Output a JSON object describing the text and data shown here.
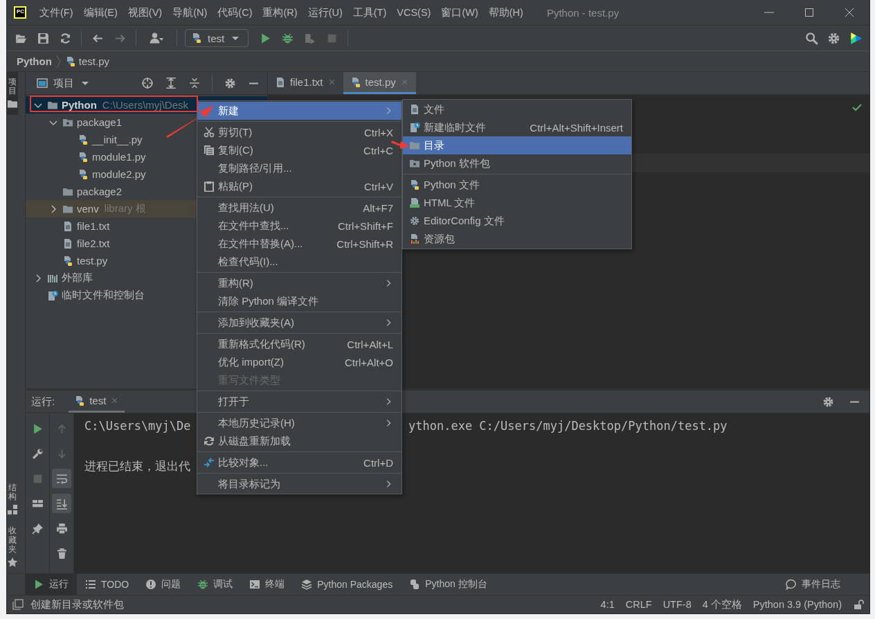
{
  "window": {
    "logo_text": "PC",
    "title": "Python - test.py"
  },
  "menu_bar": [
    "文件(F)",
    "编辑(E)",
    "视图(V)",
    "导航(N)",
    "代码(C)",
    "重构(R)",
    "运行(U)",
    "工具(T)",
    "VCS(S)",
    "窗口(W)",
    "帮助(H)"
  ],
  "toolbar": {
    "run_config": "test"
  },
  "breadcrumb": [
    "Python",
    "test.py"
  ],
  "left_stripe": {
    "top": [
      {
        "label": "项目",
        "selected": true
      }
    ],
    "bottom": [
      {
        "label": "结构",
        "kind": "structure",
        "selected": false
      },
      {
        "label": "收藏夹",
        "kind": "star",
        "selected": false
      }
    ]
  },
  "project_panel": {
    "title": "项目",
    "tree": [
      {
        "name": "Python",
        "hint": "C:\\Users\\myj\\Desk",
        "kind": "folder",
        "expanded": true,
        "selected": true,
        "excluded": false,
        "children": [
          {
            "name": "package1",
            "kind": "package",
            "expanded": true,
            "selected": false,
            "excluded": false,
            "children": [
              {
                "name": "__init__.py",
                "kind": "python",
                "selected": false,
                "excluded": false
              },
              {
                "name": "module1.py",
                "kind": "python",
                "selected": false,
                "excluded": false
              },
              {
                "name": "module2.py",
                "kind": "python",
                "selected": false,
                "excluded": false
              }
            ]
          },
          {
            "name": "package2",
            "kind": "folder",
            "selected": false,
            "excluded": false
          },
          {
            "name": "venv",
            "hint": "library 根",
            "kind": "folder",
            "expanded": false,
            "selected": false,
            "excluded": true
          },
          {
            "name": "file1.txt",
            "kind": "text",
            "selected": false,
            "excluded": false
          },
          {
            "name": "file2.txt",
            "kind": "text",
            "selected": false,
            "excluded": false
          },
          {
            "name": "test.py",
            "kind": "python",
            "selected": false,
            "excluded": false
          }
        ]
      },
      {
        "name": "外部库",
        "kind": "library",
        "expanded": false,
        "selected": false,
        "excluded": false
      },
      {
        "name": "临时文件和控制台",
        "kind": "scratch",
        "selected": false,
        "excluded": false
      }
    ]
  },
  "editor": {
    "tabs": [
      {
        "label": "file1.txt",
        "kind": "text",
        "selected": false
      },
      {
        "label": "test.py",
        "kind": "python",
        "selected": true
      }
    ]
  },
  "run_panel": {
    "title": "运行:",
    "tabs": [
      {
        "label": "test",
        "selected": true
      }
    ],
    "tools_left": [
      {
        "kind": "run"
      },
      {
        "kind": "wrench"
      },
      {
        "kind": "stop"
      },
      {
        "kind": "layout"
      },
      {
        "kind": "pin"
      }
    ],
    "tools_right": [
      {
        "kind": "up",
        "toggled": false
      },
      {
        "kind": "down",
        "toggled": false
      },
      {
        "kind": "wrap",
        "toggled": true
      },
      {
        "kind": "scroll-end",
        "toggled": true
      },
      {
        "kind": "print",
        "toggled": false
      },
      {
        "kind": "trash",
        "toggled": false
      }
    ],
    "console": [
      [
        "C:\\Users\\myj\\De",
        "ython.exe C:/Users/myj/Desktop/Python/test.py"
      ],
      [
        "进程已结束，退出代"
      ]
    ]
  },
  "tool_tabs": [
    {
      "label": "运行",
      "kind": "run",
      "selected": true
    },
    {
      "label": "TODO",
      "kind": "todo",
      "selected": false
    },
    {
      "label": "问题",
      "kind": "problems",
      "selected": false
    },
    {
      "label": "调试",
      "kind": "debug",
      "selected": false
    },
    {
      "label": "终端",
      "kind": "terminal",
      "selected": false
    },
    {
      "label": "Python Packages",
      "kind": "packages",
      "selected": false
    },
    {
      "label": "Python 控制台",
      "kind": "console",
      "selected": false
    }
  ],
  "event_log": "事件日志",
  "status_bar": {
    "message": "创建新目录或软件包",
    "items": [
      "4:1",
      "CRLF",
      "UTF-8",
      "4 个空格",
      "Python 3.9 (Python)"
    ]
  },
  "context_menu": {
    "groups": [
      [
        {
          "label": "新建",
          "submenu": true,
          "selected": true,
          "disabled": false
        }
      ],
      [
        {
          "label": "剪切(T)",
          "shortcut": "Ctrl+X",
          "submenu": false,
          "selected": false,
          "disabled": false
        },
        {
          "label": "复制(C)",
          "shortcut": "Ctrl+C",
          "submenu": false,
          "selected": false,
          "disabled": false
        },
        {
          "label": "复制路径/引用...",
          "submenu": false,
          "selected": false,
          "disabled": false
        },
        {
          "label": "粘贴(P)",
          "shortcut": "Ctrl+V",
          "submenu": false,
          "selected": false,
          "disabled": false
        }
      ],
      [
        {
          "label": "查找用法(U)",
          "shortcut": "Alt+F7",
          "submenu": false,
          "selected": false,
          "disabled": false
        },
        {
          "label": "在文件中查找...",
          "shortcut": "Ctrl+Shift+F",
          "submenu": false,
          "selected": false,
          "disabled": false
        },
        {
          "label": "在文件中替换(A)...",
          "shortcut": "Ctrl+Shift+R",
          "submenu": false,
          "selected": false,
          "disabled": false
        },
        {
          "label": "检查代码(I)...",
          "submenu": false,
          "selected": false,
          "disabled": false
        }
      ],
      [
        {
          "label": "重构(R)",
          "submenu": true,
          "selected": false,
          "disabled": false
        },
        {
          "label": "清除 Python 编译文件",
          "submenu": false,
          "selected": false,
          "disabled": false
        }
      ],
      [
        {
          "label": "添加到收藏夹(A)",
          "submenu": true,
          "selected": false,
          "disabled": false
        }
      ],
      [
        {
          "label": "重新格式化代码(R)",
          "shortcut": "Ctrl+Alt+L",
          "submenu": false,
          "selected": false,
          "disabled": false
        },
        {
          "label": "优化 import(Z)",
          "shortcut": "Ctrl+Alt+O",
          "submenu": false,
          "selected": false,
          "disabled": false
        },
        {
          "label": "重写文件类型",
          "submenu": false,
          "selected": false,
          "disabled": true
        }
      ],
      [
        {
          "label": "打开于",
          "submenu": true,
          "selected": false,
          "disabled": false
        }
      ],
      [
        {
          "label": "本地历史记录(H)",
          "submenu": true,
          "selected": false,
          "disabled": false
        },
        {
          "label": "从磁盘重新加载",
          "submenu": false,
          "selected": false,
          "disabled": false
        }
      ],
      [
        {
          "label": "比较对象...",
          "shortcut": "Ctrl+D",
          "submenu": false,
          "selected": false,
          "disabled": false
        }
      ],
      [
        {
          "label": "将目录标记为",
          "submenu": true,
          "selected": false,
          "disabled": false
        }
      ]
    ]
  },
  "submenu": {
    "groups": [
      [
        {
          "label": "文件",
          "kind": "text",
          "selected": false
        },
        {
          "label": "新建临时文件",
          "shortcut": "Ctrl+Alt+Shift+Insert",
          "kind": "scratch",
          "selected": false
        },
        {
          "label": "目录",
          "kind": "folder",
          "selected": true
        },
        {
          "label": "Python 软件包",
          "kind": "package",
          "selected": false
        }
      ],
      [
        {
          "label": "Python 文件",
          "kind": "python",
          "selected": false
        },
        {
          "label": "HTML 文件",
          "kind": "html",
          "selected": false
        },
        {
          "label": "EditorConfig 文件",
          "kind": "editorconfig",
          "selected": false
        },
        {
          "label": "资源包",
          "kind": "bundle",
          "selected": false
        }
      ]
    ]
  }
}
